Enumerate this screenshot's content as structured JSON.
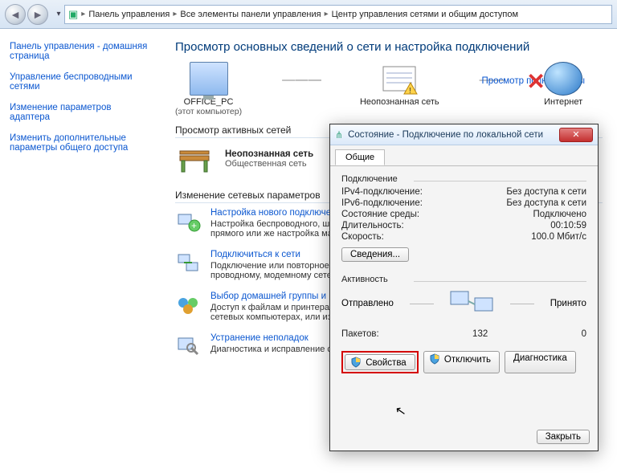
{
  "breadcrumb": {
    "items": [
      "Панель управления",
      "Все элементы панели управления",
      "Центр управления сетями и общим доступом"
    ]
  },
  "sidebar": {
    "links": [
      "Панель управления - домашняя страница",
      "Управление беспроводными сетями",
      "Изменение параметров адаптера",
      "Изменить дополнительные параметры общего доступа"
    ]
  },
  "content": {
    "heading": "Просмотр основных сведений о сети и настройка подключений",
    "map_link": "Просмотр полной карты",
    "net_items": {
      "pc": {
        "name": "OFFICE_PC",
        "sub": "(этот компьютер)"
      },
      "unknown": {
        "name": "Неопознанная сеть"
      },
      "internet": {
        "name": "Интернет"
      }
    },
    "active_title": "Просмотр активных сетей",
    "active_net": {
      "name": "Неопознанная сеть",
      "sub": "Общественная сеть"
    },
    "params_title": "Изменение сетевых параметров",
    "params": [
      {
        "link": "Настройка нового подключени",
        "desc": "Настройка беспроводного, широкополосного, модемного, прямого или же настройка маршрутизат"
      },
      {
        "link": "Подключиться к сети",
        "desc": "Подключение или повторное подключение к беспроводному, проводному, модемному сетевому соединению или подк"
      },
      {
        "link": "Выбор домашней группы и пар",
        "desc": "Доступ к файлам и принтерам, расположенным на других сетевых компьютерах, или изменение параметров общего"
      },
      {
        "link": "Устранение неполадок",
        "desc": "Диагностика и исправление сет"
      }
    ]
  },
  "dialog": {
    "title": "Состояние - Подключение по локальной сети",
    "tab": "Общие",
    "group1": "Подключение",
    "kv": [
      {
        "k": "IPv4-подключение:",
        "v": "Без доступа к сети"
      },
      {
        "k": "IPv6-подключение:",
        "v": "Без доступа к сети"
      },
      {
        "k": "Состояние среды:",
        "v": "Подключено"
      },
      {
        "k": "Длительность:",
        "v": "00:10:59"
      },
      {
        "k": "Скорость:",
        "v": "100.0 Мбит/с"
      }
    ],
    "details_btn": "Сведения...",
    "group2": "Активность",
    "sent": "Отправлено",
    "recv": "Принято",
    "packets_label": "Пакетов:",
    "packets_sent": "132",
    "packets_recv": "0",
    "btn_props": "Свойства",
    "btn_disable": "Отключить",
    "btn_diag": "Диагностика",
    "btn_close": "Закрыть"
  }
}
